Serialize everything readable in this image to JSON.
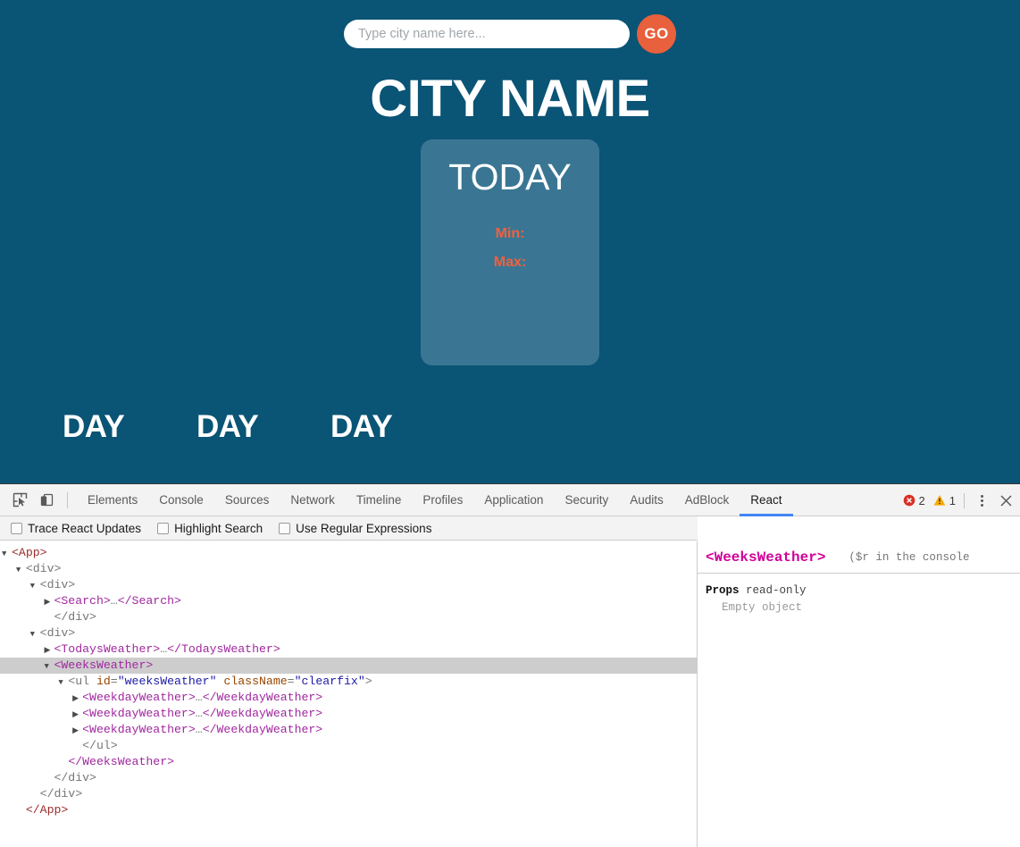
{
  "app": {
    "background_color": "#0a5475",
    "search": {
      "placeholder": "Type city name here...",
      "value": "",
      "go_label": "GO",
      "go_color": "#e8603c"
    },
    "city_name": "CITY NAME",
    "today_card": {
      "title": "TODAY",
      "background_color": "#3a7694",
      "min_label": "Min:",
      "max_label": "Max:",
      "temp_color": "#f0613c"
    },
    "week_days": [
      {
        "label": "DAY"
      },
      {
        "label": "DAY"
      },
      {
        "label": "DAY"
      }
    ]
  },
  "devtools": {
    "icons": {
      "inspect": "inspect-element-icon",
      "device": "device-toolbar-icon",
      "kebab": "more-options-icon",
      "close": "close-icon"
    },
    "tabs": [
      {
        "label": "Elements",
        "active": false
      },
      {
        "label": "Console",
        "active": false
      },
      {
        "label": "Sources",
        "active": false
      },
      {
        "label": "Network",
        "active": false
      },
      {
        "label": "Timeline",
        "active": false
      },
      {
        "label": "Profiles",
        "active": false
      },
      {
        "label": "Application",
        "active": false
      },
      {
        "label": "Security",
        "active": false
      },
      {
        "label": "Audits",
        "active": false
      },
      {
        "label": "AdBlock",
        "active": false
      },
      {
        "label": "React",
        "active": true
      }
    ],
    "status": {
      "error_count": "2",
      "warning_count": "1",
      "error_color": "#d93025",
      "warning_color": "#f9ab00"
    },
    "options": [
      {
        "label": "Trace React Updates",
        "checked": false
      },
      {
        "label": "Highlight Search",
        "checked": false
      },
      {
        "label": "Use Regular Expressions",
        "checked": false
      }
    ],
    "tree": [
      {
        "indent": 0,
        "arrow": "down",
        "selected": false,
        "parts": [
          {
            "t": "app",
            "v": "<App>"
          }
        ]
      },
      {
        "indent": 1,
        "arrow": "down",
        "selected": false,
        "parts": [
          {
            "t": "html",
            "v": "<div>"
          }
        ]
      },
      {
        "indent": 2,
        "arrow": "down",
        "selected": false,
        "parts": [
          {
            "t": "html",
            "v": "<div>"
          }
        ]
      },
      {
        "indent": 3,
        "arrow": "right",
        "selected": false,
        "parts": [
          {
            "t": "comp",
            "v": "<Search>"
          },
          {
            "t": "punct",
            "v": "…"
          },
          {
            "t": "comp",
            "v": "</Search>"
          }
        ]
      },
      {
        "indent": 3,
        "arrow": "none",
        "selected": false,
        "parts": [
          {
            "t": "html",
            "v": "</div>"
          }
        ]
      },
      {
        "indent": 2,
        "arrow": "down",
        "selected": false,
        "parts": [
          {
            "t": "html",
            "v": "<div>"
          }
        ]
      },
      {
        "indent": 3,
        "arrow": "right",
        "selected": false,
        "parts": [
          {
            "t": "comp",
            "v": "<TodaysWeather>"
          },
          {
            "t": "punct",
            "v": "…"
          },
          {
            "t": "comp",
            "v": "</TodaysWeather>"
          }
        ]
      },
      {
        "indent": 3,
        "arrow": "down",
        "selected": true,
        "parts": [
          {
            "t": "comp",
            "v": "<WeeksWeather>"
          }
        ]
      },
      {
        "indent": 4,
        "arrow": "down",
        "selected": false,
        "parts": [
          {
            "t": "html",
            "v": "<ul "
          },
          {
            "t": "attr",
            "v": "id"
          },
          {
            "t": "punct",
            "v": "="
          },
          {
            "t": "val",
            "v": "\"weeksWeather\""
          },
          {
            "t": "html",
            "v": " "
          },
          {
            "t": "attr",
            "v": "className"
          },
          {
            "t": "punct",
            "v": "="
          },
          {
            "t": "val",
            "v": "\"clearfix\""
          },
          {
            "t": "html",
            "v": ">"
          }
        ]
      },
      {
        "indent": 5,
        "arrow": "right",
        "selected": false,
        "parts": [
          {
            "t": "comp",
            "v": "<WeekdayWeather>"
          },
          {
            "t": "punct",
            "v": "…"
          },
          {
            "t": "comp",
            "v": "</WeekdayWeather>"
          }
        ]
      },
      {
        "indent": 5,
        "arrow": "right",
        "selected": false,
        "parts": [
          {
            "t": "comp",
            "v": "<WeekdayWeather>"
          },
          {
            "t": "punct",
            "v": "…"
          },
          {
            "t": "comp",
            "v": "</WeekdayWeather>"
          }
        ]
      },
      {
        "indent": 5,
        "arrow": "right",
        "selected": false,
        "parts": [
          {
            "t": "comp",
            "v": "<WeekdayWeather>"
          },
          {
            "t": "punct",
            "v": "…"
          },
          {
            "t": "comp",
            "v": "</WeekdayWeather>"
          }
        ]
      },
      {
        "indent": 5,
        "arrow": "none",
        "selected": false,
        "parts": [
          {
            "t": "html",
            "v": "</ul>"
          }
        ]
      },
      {
        "indent": 4,
        "arrow": "none",
        "selected": false,
        "parts": [
          {
            "t": "comp",
            "v": "</WeeksWeather>"
          }
        ]
      },
      {
        "indent": 3,
        "arrow": "none",
        "selected": false,
        "parts": [
          {
            "t": "html",
            "v": "</div>"
          }
        ]
      },
      {
        "indent": 2,
        "arrow": "none",
        "selected": false,
        "parts": [
          {
            "t": "html",
            "v": "</div>"
          }
        ]
      },
      {
        "indent": 1,
        "arrow": "none",
        "selected": false,
        "parts": [
          {
            "t": "app",
            "v": "</App>"
          }
        ]
      }
    ],
    "props_panel": {
      "component_name": "<WeeksWeather>",
      "hint": "($r in the console",
      "props_label": "Props",
      "props_readonly": "read-only",
      "props_value": "Empty object"
    }
  }
}
